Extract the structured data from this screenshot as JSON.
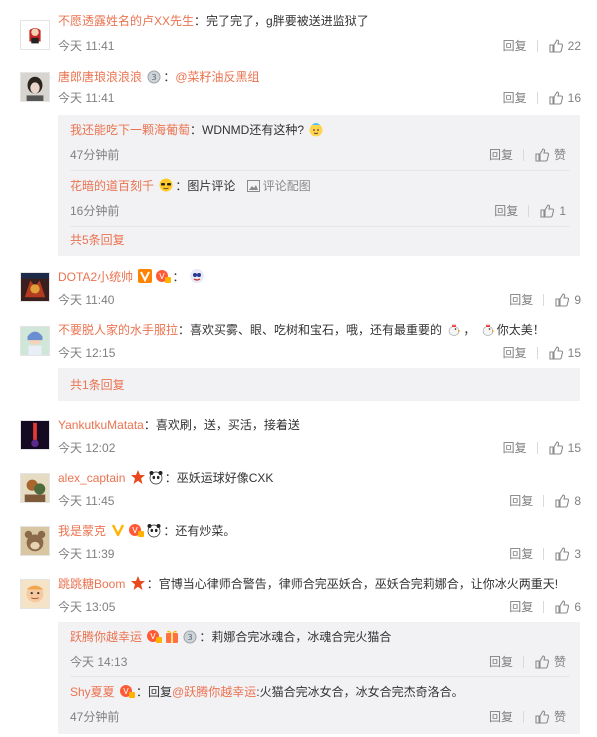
{
  "ui": {
    "reply": "回复",
    "like": "赞",
    "accent": "#eb7350",
    "sub_bg": "#f2f2f5"
  },
  "comments": [
    {
      "user": "不愿透露姓名的卢XX先生",
      "text": "：完了完了，g胖要被送进监狱了",
      "time": "今天 11:41",
      "likes": "22"
    },
    {
      "user": "唐郎唐琅浪浪浪",
      "text": "：",
      "link": "@菜籽油反黑组",
      "time": "今天 11:41",
      "likes": "16",
      "replies": [
        {
          "user": "我还能吃下一颗海葡萄",
          "text": "：WDNMD还有这种?",
          "time": "47分钟前",
          "likes": "赞"
        },
        {
          "user": "花暗的道百刻千",
          "text": "：图片评论",
          "pic_link": "评论配图",
          "time": "16分钟前",
          "likes": "1"
        }
      ],
      "more": "共5条回复"
    },
    {
      "user": "DOTA2小统帅",
      "text": "：",
      "time": "今天 11:40",
      "likes": "9"
    },
    {
      "user": "不要脱人家的水手服拉",
      "text": "：喜欢买雾、眼、吃树和宝石，哦，还有最重要的",
      "text2": "，",
      "text3": "你太美！",
      "time": "今天 12:15",
      "likes": "15",
      "more": "共1条回复"
    },
    {
      "user": "YankutkuMatata",
      "text": "：喜欢刷，送，买活，接着送",
      "time": "今天 12:02",
      "likes": "15"
    },
    {
      "user": "alex_captain",
      "text": "：巫妖运球好像CXK",
      "time": "今天 11:45",
      "likes": "8"
    },
    {
      "user": "我是蒙克",
      "text": "：还有炒菜。",
      "time": "今天 11:39",
      "likes": "3"
    },
    {
      "user": "跳跳糖Boom",
      "text": "：官博当心律师合警告，律师合完巫妖合，巫妖合完莉娜合，让你冰火两重天!",
      "time": "今天 13:05",
      "likes": "6",
      "replies": [
        {
          "user": "跃腾你越幸运",
          "text": "：莉娜合完冰魂合，冰魂合完火猫合",
          "time": "今天 14:13",
          "likes": "赞"
        },
        {
          "user": "Shy夏夏",
          "text": "：回复",
          "link": "@跃腾你越幸运",
          "text2": ":火猫合完冰女合，冰女合完杰奇洛合。",
          "time": "47分钟前",
          "likes": "赞"
        }
      ]
    }
  ]
}
